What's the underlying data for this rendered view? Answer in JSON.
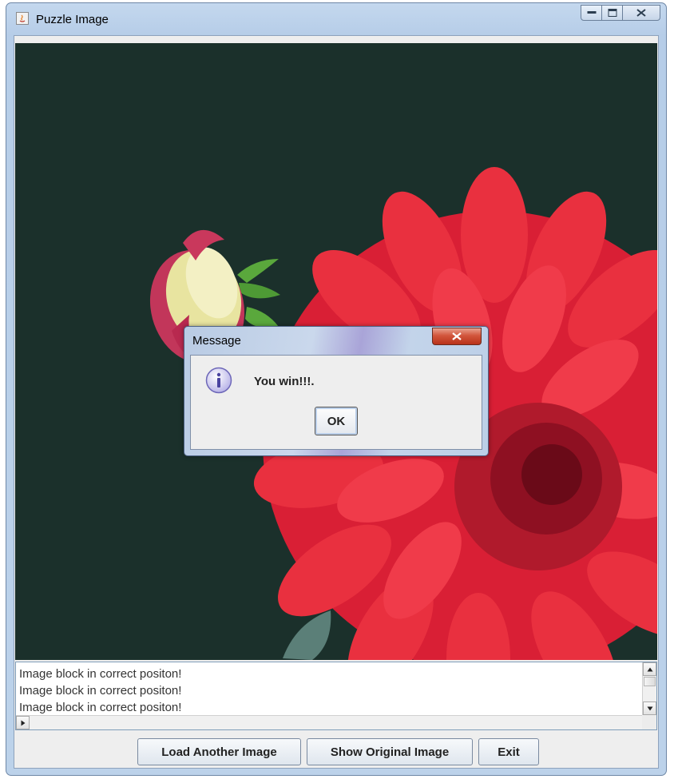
{
  "window": {
    "title": "Puzzle Image",
    "controls": [
      "minimize",
      "maximize",
      "close"
    ]
  },
  "puzzle": {
    "image_description_icon": "dahlia-flower-image",
    "background_color": "#1b302b",
    "petal_color": "#e3283a"
  },
  "log": {
    "lines": [
      "Image block in correct positon!",
      "Image block in correct positon!",
      "Image block in correct positon!"
    ]
  },
  "buttons": {
    "load": "Load Another Image",
    "show": "Show Original Image",
    "exit": "Exit"
  },
  "dialog": {
    "title": "Message",
    "message": "You win!!!.",
    "ok": "OK",
    "icon": "info-icon"
  }
}
